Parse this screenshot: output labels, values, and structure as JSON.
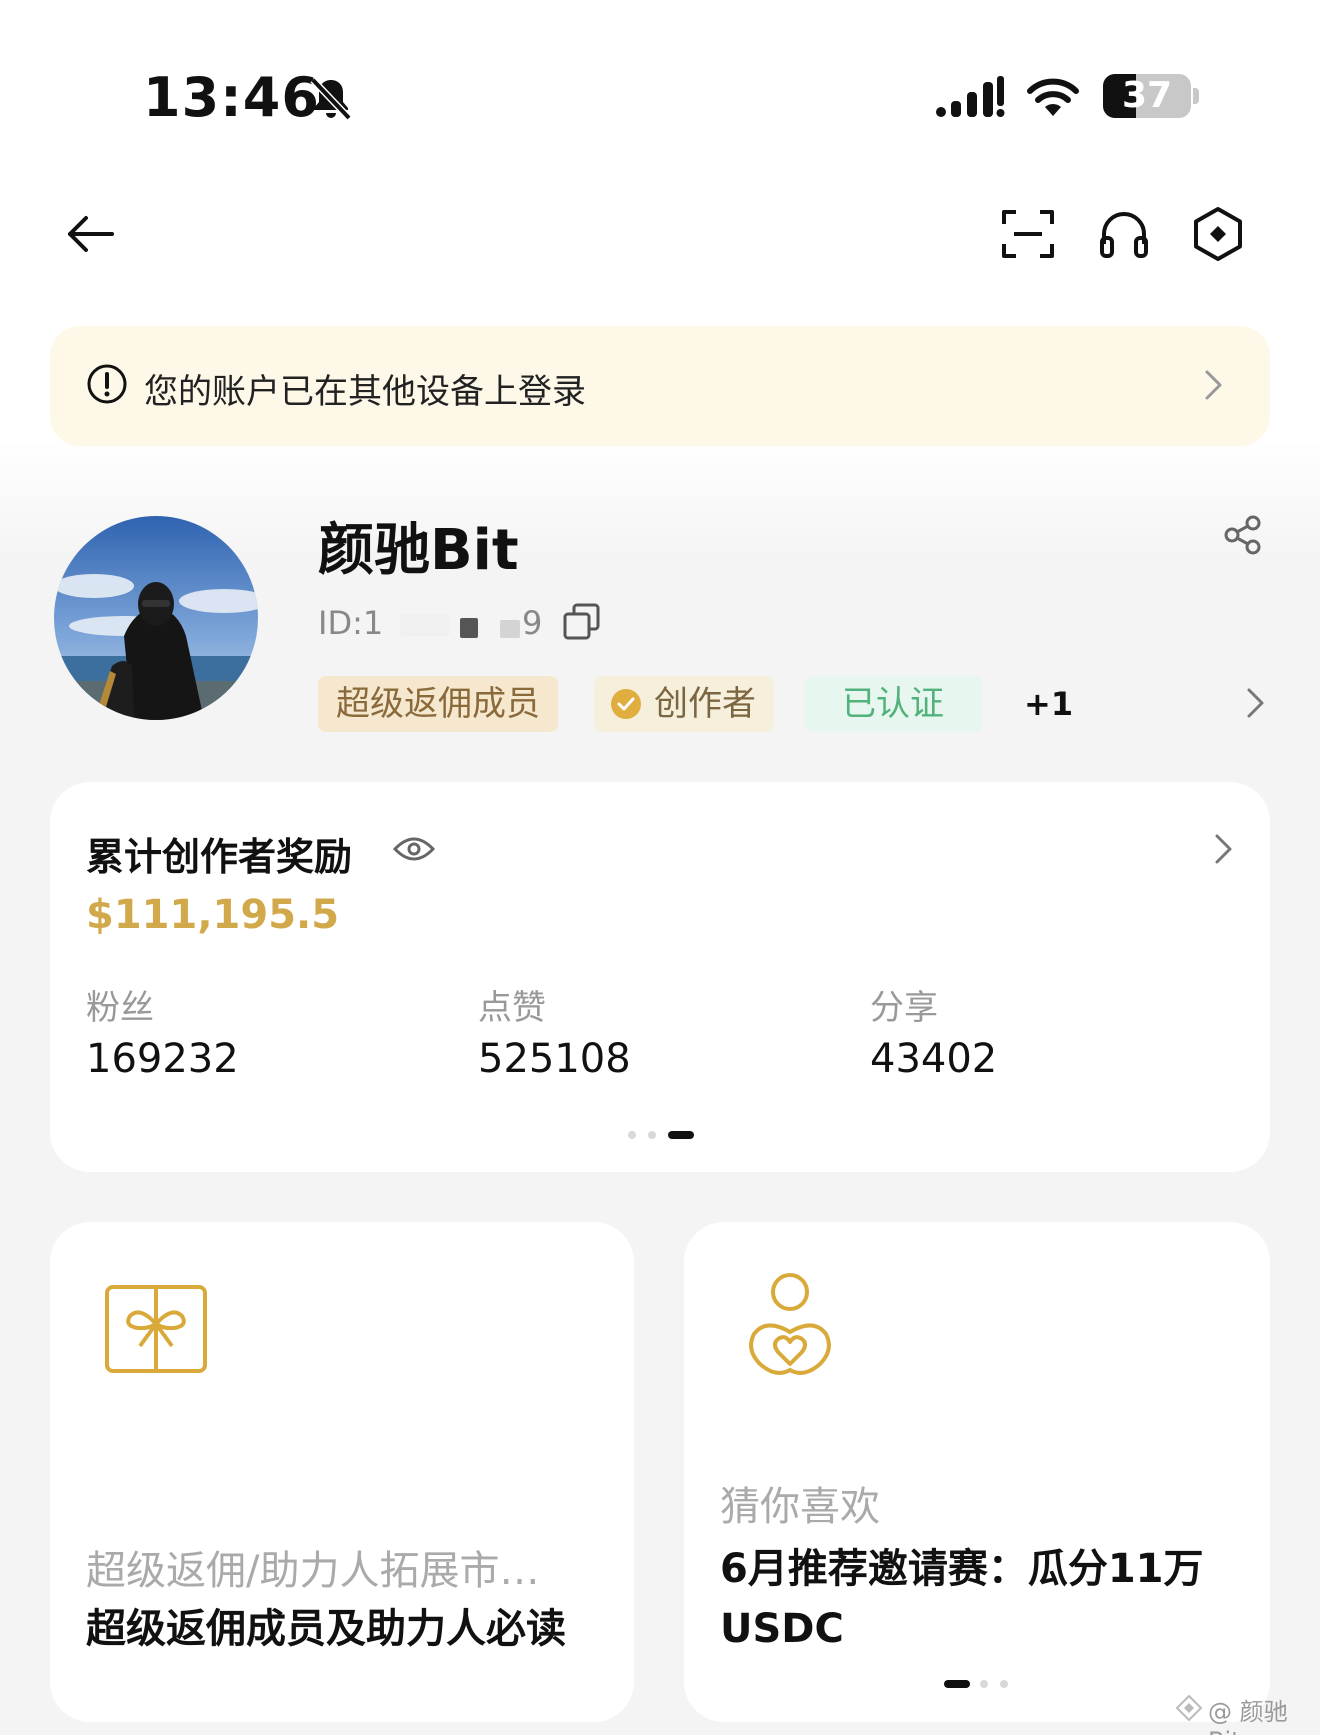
{
  "status_bar": {
    "time": "13:46",
    "battery_level": "37",
    "battery_fraction": 0.37,
    "icons": [
      "bell-slash-icon",
      "cellular-signal-icon",
      "wifi-icon",
      "battery-icon"
    ]
  },
  "nav": {
    "icons": [
      "back-arrow-icon",
      "scan-icon",
      "headset-icon",
      "settings-hexagon-icon"
    ]
  },
  "banner": {
    "text": "您的账户已在其他设备上登录",
    "icons": [
      "alert-circle-icon",
      "chevron-right-icon"
    ]
  },
  "profile": {
    "username": "颜驰Bit",
    "id_prefix": "ID:1",
    "id_suffix": "9",
    "badges": {
      "rebate": "超级返佣成员",
      "creator": "创作者",
      "verified": "已认证",
      "more": "+1"
    },
    "icons": [
      "share-icon",
      "copy-icon",
      "creator-check-icon"
    ]
  },
  "stats": {
    "reward_title": "累计创作者奖励",
    "reward_value": "$111,195.5",
    "items": [
      {
        "label": "粉丝",
        "value": "169232"
      },
      {
        "label": "点赞",
        "value": "525108"
      },
      {
        "label": "分享",
        "value": "43402"
      }
    ],
    "icons": [
      "eye-icon",
      "chevron-right-icon"
    ]
  },
  "cards": {
    "left": {
      "subtitle": "超级返佣/助力人拓展市…",
      "title": "超级返佣成员及助力人必读",
      "icon": "gift-box-icon"
    },
    "right": {
      "subtitle": "猜你喜欢",
      "title_line1": "6月推荐邀请赛：瓜分11万",
      "title_line2": "USDC",
      "icon": "person-heart-icon"
    }
  },
  "watermark": "@ 颜驰Bit",
  "colors": {
    "accent_gold": "#d2a94a",
    "banner_bg": "#fdf8e8",
    "verified_green": "#52b27c"
  }
}
